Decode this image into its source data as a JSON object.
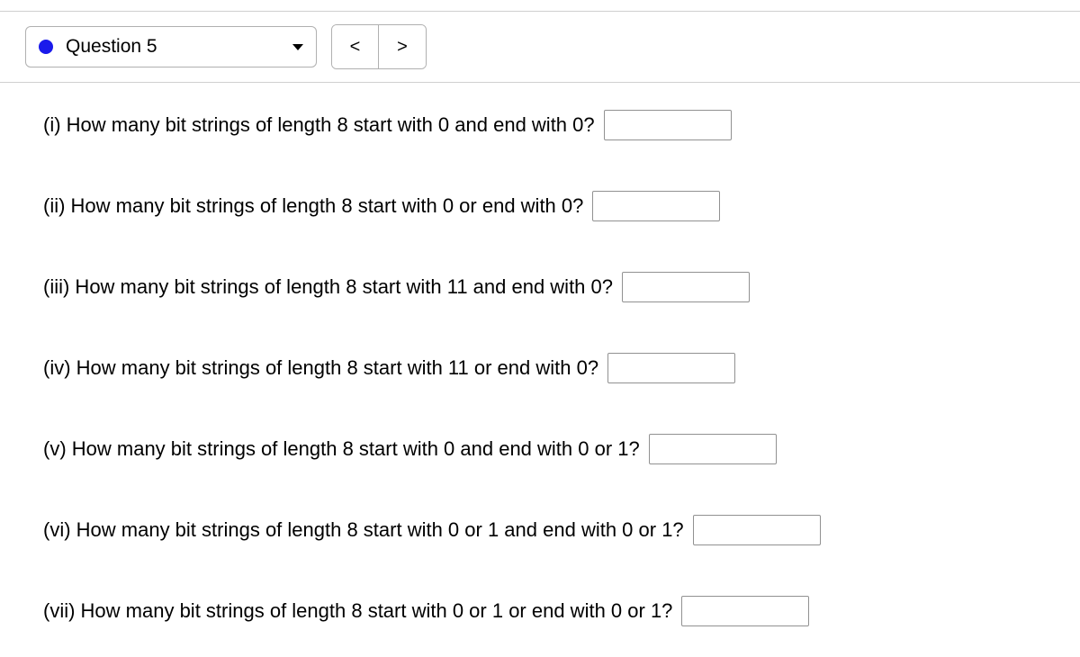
{
  "toolbar": {
    "question_label": "Question 5",
    "prev_symbol": "<",
    "next_symbol": ">"
  },
  "questions": [
    {
      "text": "(i) How many bit strings of length 8 start with 0 and end with 0?"
    },
    {
      "text": "(ii) How many bit strings of length 8 start with 0 or end with 0?"
    },
    {
      "text": "(iii) How many bit strings of length 8 start with 11 and end with 0?"
    },
    {
      "text": "(iv) How many bit strings of length 8 start with 11 or end with 0?"
    },
    {
      "text": "(v) How many bit strings of length 8 start with 0 and end with 0 or 1?"
    },
    {
      "text": "(vi) How many bit strings of length 8 start with 0 or 1 and end with 0 or 1?"
    },
    {
      "text": "(vii) How many bit strings of length 8 start with 0 or 1 or end with 0 or 1?"
    }
  ]
}
